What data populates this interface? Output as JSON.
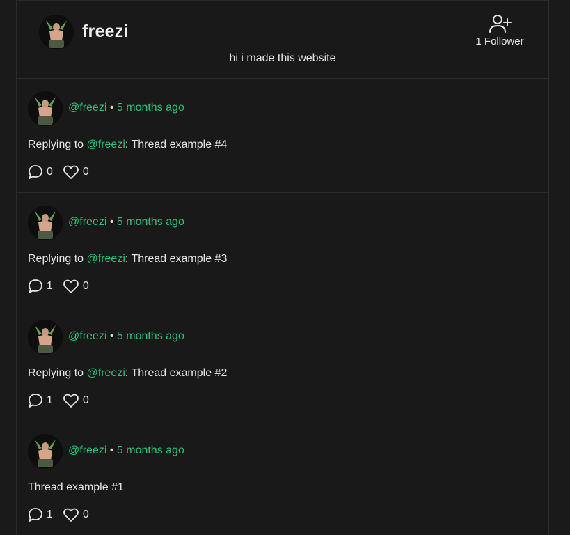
{
  "profile": {
    "username": "freezi",
    "bio": "hi i made this website",
    "follower_label": "1 Follower",
    "follow_icon": "user-plus-icon"
  },
  "posts": [
    {
      "handle": "@freezi",
      "separator": "•",
      "time": "5 months ago",
      "reply_prefix": "Replying to",
      "reply_to": "@freezi",
      "reply_colon": ":",
      "text": " Thread example #4",
      "comments": "0",
      "likes": "0"
    },
    {
      "handle": "@freezi",
      "separator": "•",
      "time": "5 months ago",
      "reply_prefix": "Replying to",
      "reply_to": "@freezi",
      "reply_colon": ":",
      "text": " Thread example #3",
      "comments": "1",
      "likes": "0"
    },
    {
      "handle": "@freezi",
      "separator": "•",
      "time": "5 months ago",
      "reply_prefix": "Replying to",
      "reply_to": "@freezi",
      "reply_colon": ":",
      "text": " Thread example #2",
      "comments": "1",
      "likes": "0"
    },
    {
      "handle": "@freezi",
      "separator": "•",
      "time": "5 months ago",
      "text": "Thread example #1",
      "comments": "1",
      "likes": "0"
    }
  ],
  "colors": {
    "accent": "#2fc07a",
    "background": "#191919",
    "border": "#2c2c2c"
  }
}
